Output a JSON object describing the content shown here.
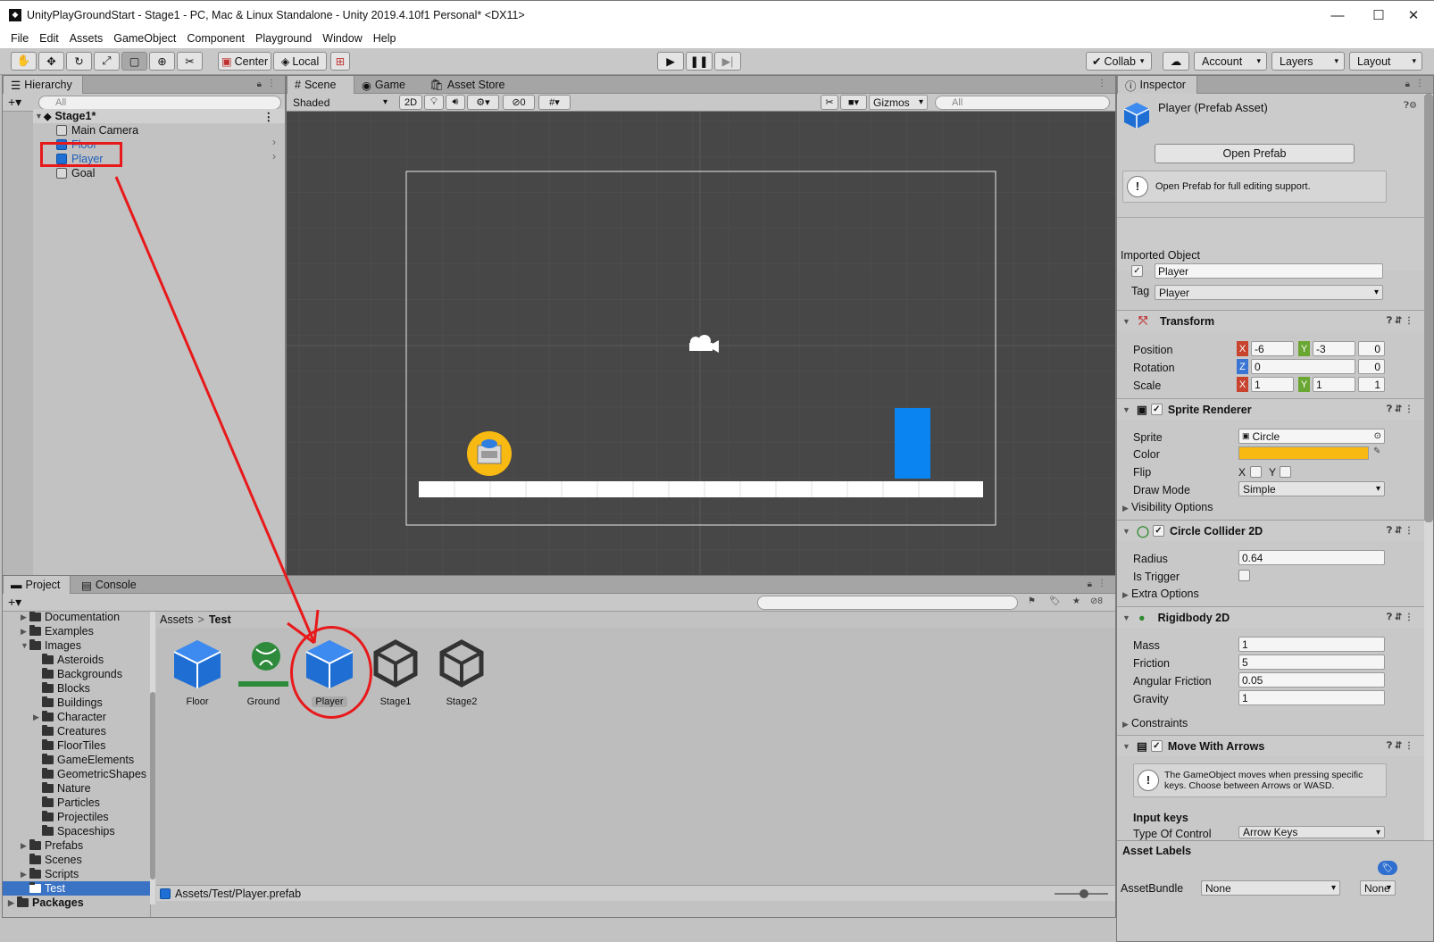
{
  "window": {
    "title": "UnityPlayGroundStart - Stage1 - PC, Mac & Linux Standalone - Unity 2019.4.10f1 Personal* <DX11>",
    "minimize": "—",
    "maximize": "☐",
    "close": "✕"
  },
  "menu": [
    "File",
    "Edit",
    "Assets",
    "GameObject",
    "Component",
    "Playground",
    "Window",
    "Help"
  ],
  "toolbar": {
    "center": "Center",
    "local": "Local",
    "collab": "Collab",
    "account": "Account",
    "layers": "Layers",
    "layout": "Layout"
  },
  "hierarchy": {
    "tab": "Hierarchy",
    "search_placeholder": "All",
    "scene": "Stage1*",
    "items": [
      "Main Camera",
      "Floor",
      "Player",
      "Goal"
    ]
  },
  "scene_view": {
    "tabs": [
      "Scene",
      "Game",
      "Asset Store"
    ],
    "shading": "Shaded",
    "mode_2d": "2D",
    "hidden_count": "0",
    "gizmos": "Gizmos",
    "search_placeholder": "All"
  },
  "project": {
    "tabs": [
      "Project",
      "Console"
    ],
    "hidden_count": "8",
    "tree": [
      {
        "label": "Documentation",
        "depth": 1,
        "arrow": "▶"
      },
      {
        "label": "Examples",
        "depth": 1,
        "arrow": "▶"
      },
      {
        "label": "Images",
        "depth": 1,
        "arrow": "▼"
      },
      {
        "label": "Asteroids",
        "depth": 2,
        "arrow": ""
      },
      {
        "label": "Backgrounds",
        "depth": 2,
        "arrow": ""
      },
      {
        "label": "Blocks",
        "depth": 2,
        "arrow": ""
      },
      {
        "label": "Buildings",
        "depth": 2,
        "arrow": ""
      },
      {
        "label": "Character",
        "depth": 2,
        "arrow": "▶"
      },
      {
        "label": "Creatures",
        "depth": 2,
        "arrow": ""
      },
      {
        "label": "FloorTiles",
        "depth": 2,
        "arrow": ""
      },
      {
        "label": "GameElements",
        "depth": 2,
        "arrow": ""
      },
      {
        "label": "GeometricShapes",
        "depth": 2,
        "arrow": ""
      },
      {
        "label": "Nature",
        "depth": 2,
        "arrow": ""
      },
      {
        "label": "Particles",
        "depth": 2,
        "arrow": ""
      },
      {
        "label": "Projectiles",
        "depth": 2,
        "arrow": ""
      },
      {
        "label": "Spaceships",
        "depth": 2,
        "arrow": ""
      },
      {
        "label": "Prefabs",
        "depth": 1,
        "arrow": "▶"
      },
      {
        "label": "Scenes",
        "depth": 1,
        "arrow": ""
      },
      {
        "label": "Scripts",
        "depth": 1,
        "arrow": "▶"
      },
      {
        "label": "Test",
        "depth": 1,
        "arrow": ""
      },
      {
        "label": "Packages",
        "depth": 0,
        "arrow": "▶"
      }
    ],
    "breadcrumb": [
      "Assets",
      "Test"
    ],
    "breadcrumb_sep": ">",
    "assets": [
      "Floor",
      "Ground",
      "Player",
      "Stage1",
      "Stage2"
    ],
    "status_path": "Assets/Test/Player.prefab"
  },
  "inspector": {
    "tab": "Inspector",
    "title": "Player (Prefab Asset)",
    "open_prefab": "Open Prefab",
    "open_prefab_note": "Open Prefab for full editing support.",
    "imported_object": "Imported Object",
    "name": "Player",
    "tag_label": "Tag",
    "tag": "Player",
    "transform": {
      "title": "Transform",
      "position_label": "Position",
      "pos_x": "-6",
      "pos_y": "-3",
      "pos_z": "0",
      "rotation_label": "Rotation",
      "rot_z": "0",
      "rot_extra": "0",
      "scale_label": "Scale",
      "scale_x": "1",
      "scale_y": "1",
      "scale_z": "1"
    },
    "sprite_renderer": {
      "title": "Sprite Renderer",
      "sprite_label": "Sprite",
      "sprite": "Circle",
      "color_label": "Color",
      "color": "#f7b912",
      "flip_label": "Flip",
      "flip_x": "X",
      "flip_y": "Y",
      "draw_mode_label": "Draw Mode",
      "draw_mode": "Simple",
      "visibility": "Visibility Options"
    },
    "circle_collider": {
      "title": "Circle Collider 2D",
      "radius_label": "Radius",
      "radius": "0.64",
      "trigger_label": "Is Trigger",
      "extra": "Extra Options"
    },
    "rigidbody": {
      "title": "Rigidbody 2D",
      "mass_label": "Mass",
      "mass": "1",
      "friction_label": "Friction",
      "friction": "5",
      "ang_label": "Angular Friction",
      "ang": "0.05",
      "gravity_label": "Gravity",
      "gravity": "1",
      "constraints": "Constraints"
    },
    "move_with_arrows": {
      "title": "Move With Arrows",
      "note": "The GameObject moves when pressing specific keys. Choose between Arrows or WASD.",
      "input_keys": "Input keys",
      "type_label": "Type Of Control",
      "type": "Arrow Keys"
    },
    "asset_labels": "Asset Labels",
    "asset_bundle_label": "AssetBundle",
    "asset_bundle": "None",
    "asset_bundle_variant": "None"
  },
  "colors": {
    "accent_blue": "#1f6ed4",
    "selection": "#3a72c4",
    "annotation_red": "#e8191b",
    "goal_blue": "#0a84f0"
  }
}
